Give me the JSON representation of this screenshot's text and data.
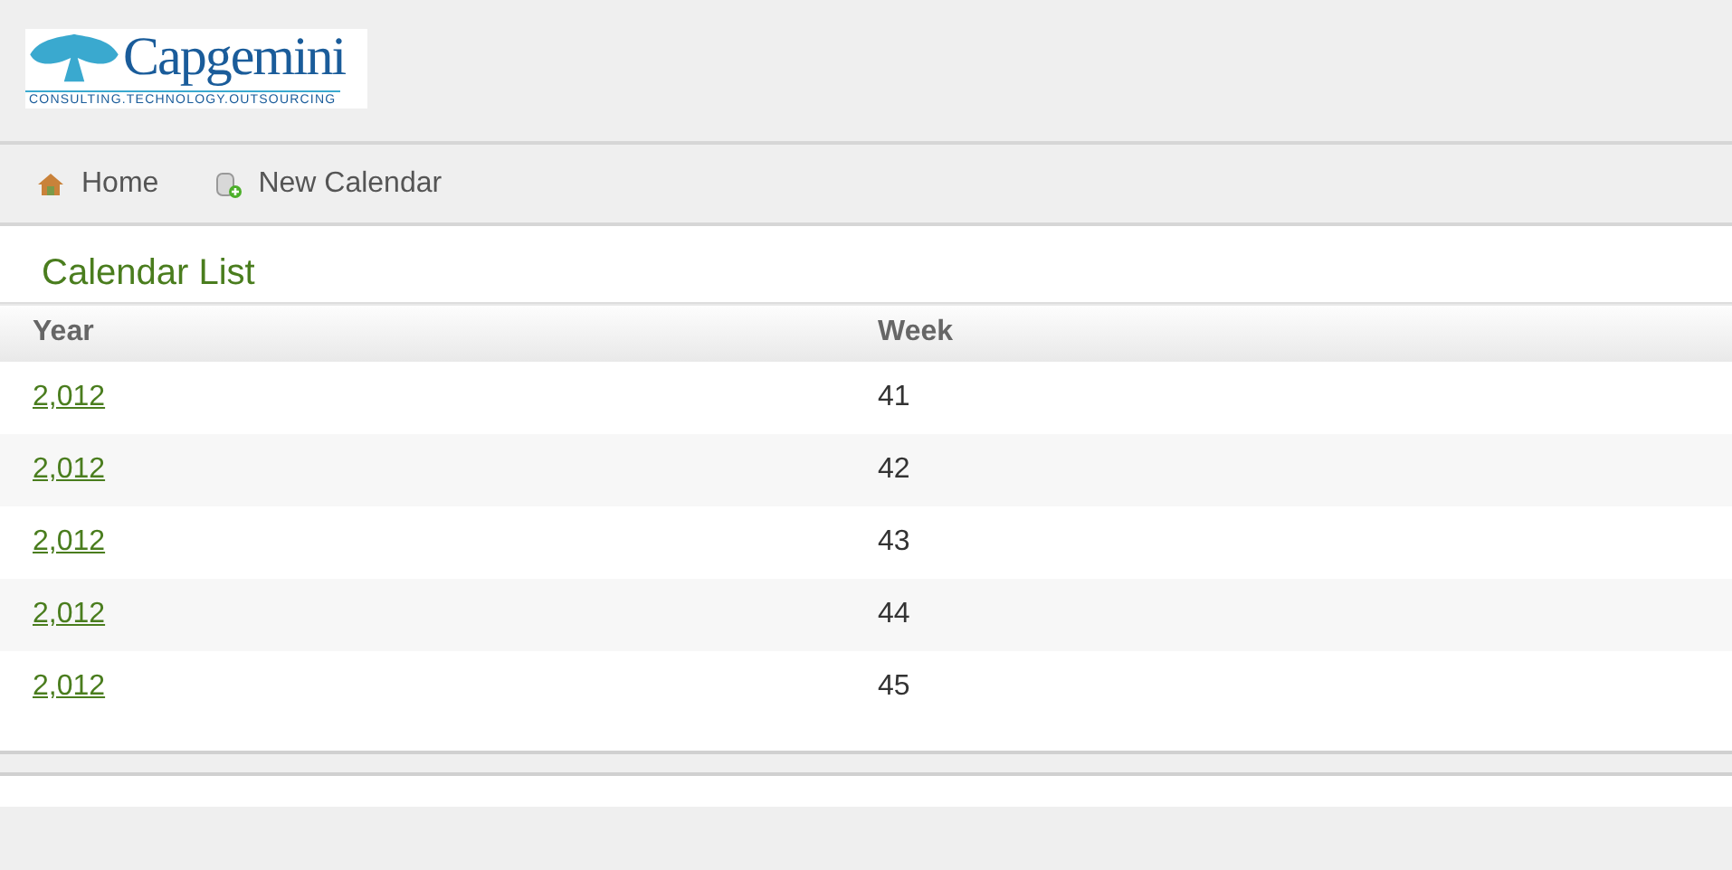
{
  "logo": {
    "name": "Capgemini",
    "tagline": "CONSULTING.TECHNOLOGY.OUTSOURCING"
  },
  "nav": [
    {
      "label": "Home",
      "kind": "home"
    },
    {
      "label": "New Calendar",
      "kind": "new"
    }
  ],
  "title": "Calendar List",
  "table": {
    "columns": [
      "Year",
      "Week"
    ],
    "rows": [
      [
        "2,012",
        "41"
      ],
      [
        "2,012",
        "42"
      ],
      [
        "2,012",
        "43"
      ],
      [
        "2,012",
        "44"
      ],
      [
        "2,012",
        "45"
      ]
    ]
  }
}
